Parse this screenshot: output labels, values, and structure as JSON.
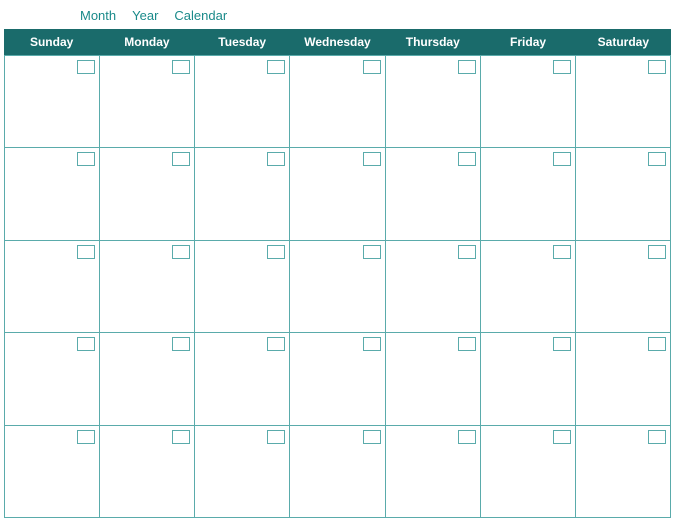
{
  "nav": {
    "items": [
      {
        "label": "Month",
        "id": "month"
      },
      {
        "label": "Year",
        "id": "year"
      },
      {
        "label": "Calendar",
        "id": "calendar"
      }
    ]
  },
  "calendar": {
    "headers": [
      "Sunday",
      "Monday",
      "Tuesday",
      "Wednesday",
      "Thursday",
      "Friday",
      "Saturday"
    ],
    "rows": 5,
    "cols": 7
  }
}
